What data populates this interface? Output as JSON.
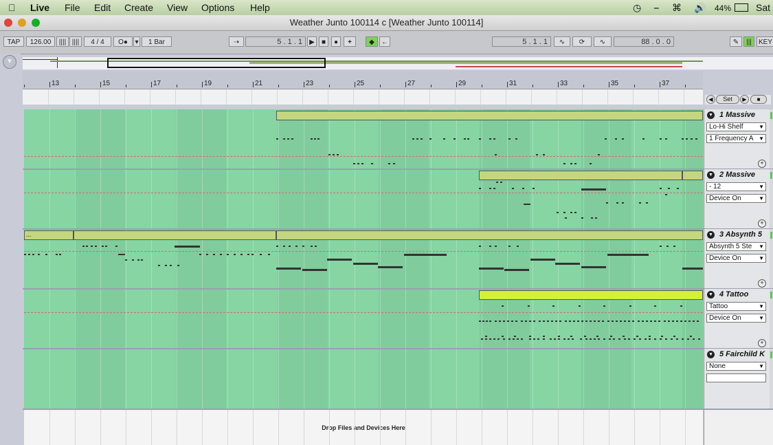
{
  "menubar": {
    "app": "Live",
    "items": [
      "File",
      "Edit",
      "Create",
      "View",
      "Options",
      "Help"
    ],
    "battery": "44%",
    "day": "Sat"
  },
  "window": {
    "title": "Weather Junto 100114 c  [Weather Junto 100114]"
  },
  "controlbar": {
    "tap": "TAP",
    "tempo": "126.00",
    "signature": "4 / 4",
    "quantize": "1 Bar",
    "song_position": "5 . 1 . 1",
    "loop_start": "5 . 1 . 1",
    "loop_length": "88 . 0 . 0",
    "key": "KEY"
  },
  "ruler": {
    "labels": [
      "13",
      "15",
      "17",
      "19",
      "21",
      "23",
      "25",
      "27",
      "29",
      "31",
      "33",
      "35",
      "37"
    ]
  },
  "loop": {
    "set_label": "Set"
  },
  "tracks": [
    {
      "name": "1 Massive",
      "device": "Lo-Hi Shelf",
      "param": "1 Frequency A"
    },
    {
      "name": "2 Massive",
      "device": "- 12",
      "param": "Device On"
    },
    {
      "name": "3 Absynth 5",
      "device": "Absynth 5 Ste",
      "param": "Device On",
      "clip_label": "..."
    },
    {
      "name": "4 Tattoo",
      "device": "Tattoo",
      "param": "Device On"
    },
    {
      "name": "5 Fairchild K",
      "device": "None",
      "param": ""
    }
  ],
  "dropzone": {
    "label": "Drop Files and Devices Here"
  },
  "colors": {
    "track_bg": "#86d5a3",
    "clip": "#c4d77e",
    "clip_selected": "#d4f03a",
    "envelope": "#d36a7a"
  }
}
